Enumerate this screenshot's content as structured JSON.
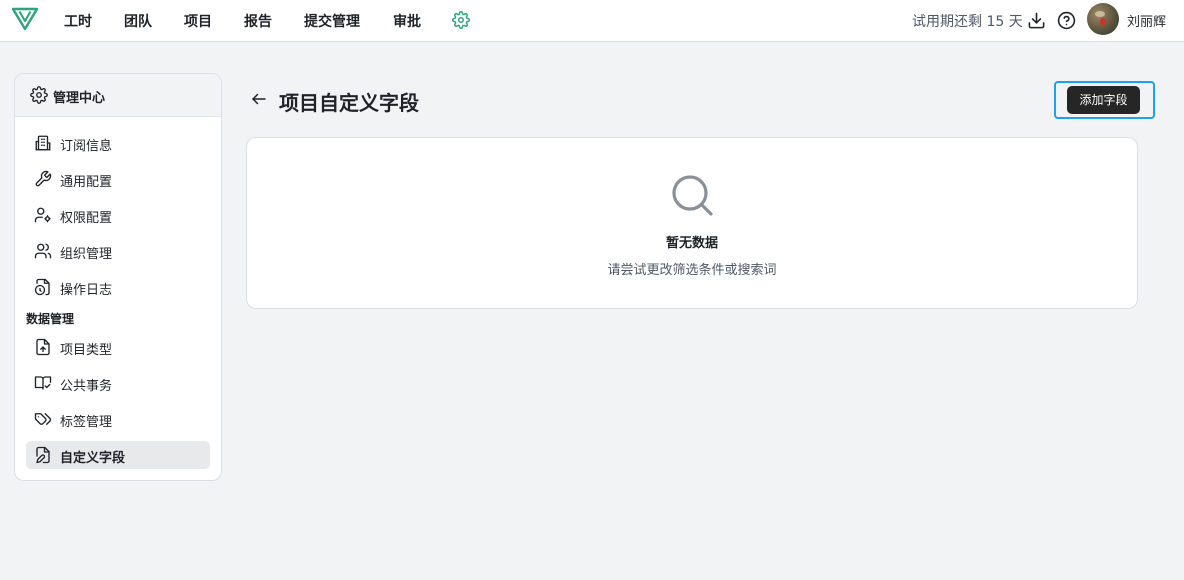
{
  "topbar": {
    "nav": [
      "工时",
      "团队",
      "项目",
      "报告",
      "提交管理",
      "审批"
    ],
    "trial_text": "试用期还剩 15 天",
    "username": "刘丽辉",
    "accent": "#2fa37a"
  },
  "sidebar": {
    "header": "管理中心",
    "items": [
      {
        "label": "订阅信息",
        "icon": "building-icon"
      },
      {
        "label": "通用配置",
        "icon": "wrench-icon"
      },
      {
        "label": "权限配置",
        "icon": "user-key-icon"
      },
      {
        "label": "组织管理",
        "icon": "users-icon"
      },
      {
        "label": "操作日志",
        "icon": "file-clock-icon"
      }
    ],
    "section_title": "数据管理",
    "data_items": [
      {
        "label": "项目类型",
        "icon": "file-upload-icon"
      },
      {
        "label": "公共事务",
        "icon": "book-icon"
      },
      {
        "label": "标签管理",
        "icon": "tags-icon"
      },
      {
        "label": "自定义字段",
        "icon": "file-edit-icon",
        "active": true
      }
    ]
  },
  "main": {
    "title": "项目自定义字段",
    "add_button": "添加字段",
    "empty_title": "暂无数据",
    "empty_subtitle": "请尝试更改筛选条件或搜索词"
  },
  "colors": {
    "highlight_border": "#1aa3e8",
    "button_bg": "#262626",
    "empty_icon": "#8a9099"
  }
}
